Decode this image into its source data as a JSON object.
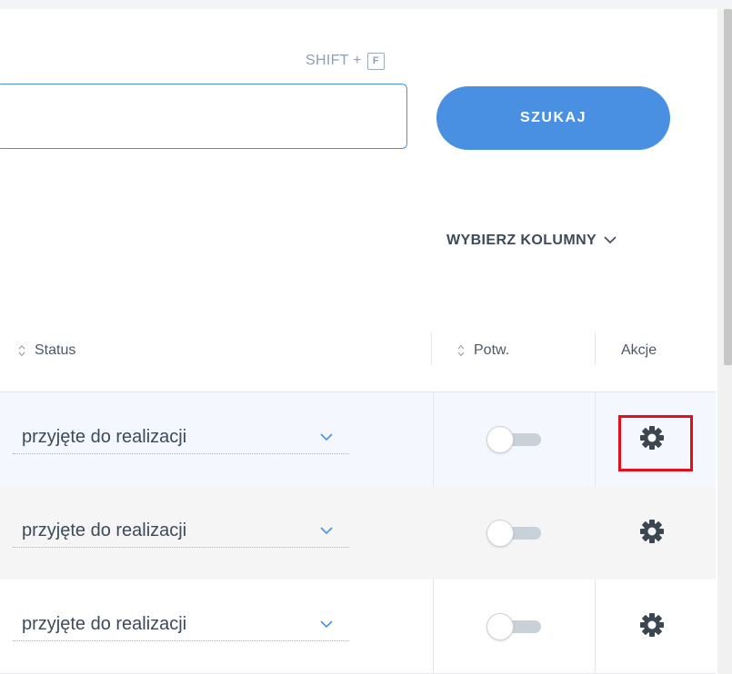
{
  "search": {
    "shortcut_prefix": "SHIFT +",
    "shortcut_key": "F",
    "input_value": "",
    "button_label": "SZUKAJ"
  },
  "columns_button": {
    "label": "WYBIERZ KOLUMNY",
    "icon": "chevron-down-icon"
  },
  "table": {
    "headers": {
      "status": "Status",
      "confirmed": "Potw.",
      "actions": "Akcje"
    },
    "rows": [
      {
        "status": "przyjęte do realizacji",
        "confirmed": false,
        "action_icon": "gear-icon",
        "background": "#f4f7fd"
      },
      {
        "status": "przyjęte do realizacji",
        "confirmed": false,
        "action_icon": "gear-icon",
        "background": "#f5f5f5"
      },
      {
        "status": "przyjęte do realizacji",
        "confirmed": false,
        "action_icon": "gear-icon",
        "background": "#ffffff"
      }
    ]
  },
  "colors": {
    "accent": "#4a90e2",
    "highlight": "#e3101b"
  }
}
